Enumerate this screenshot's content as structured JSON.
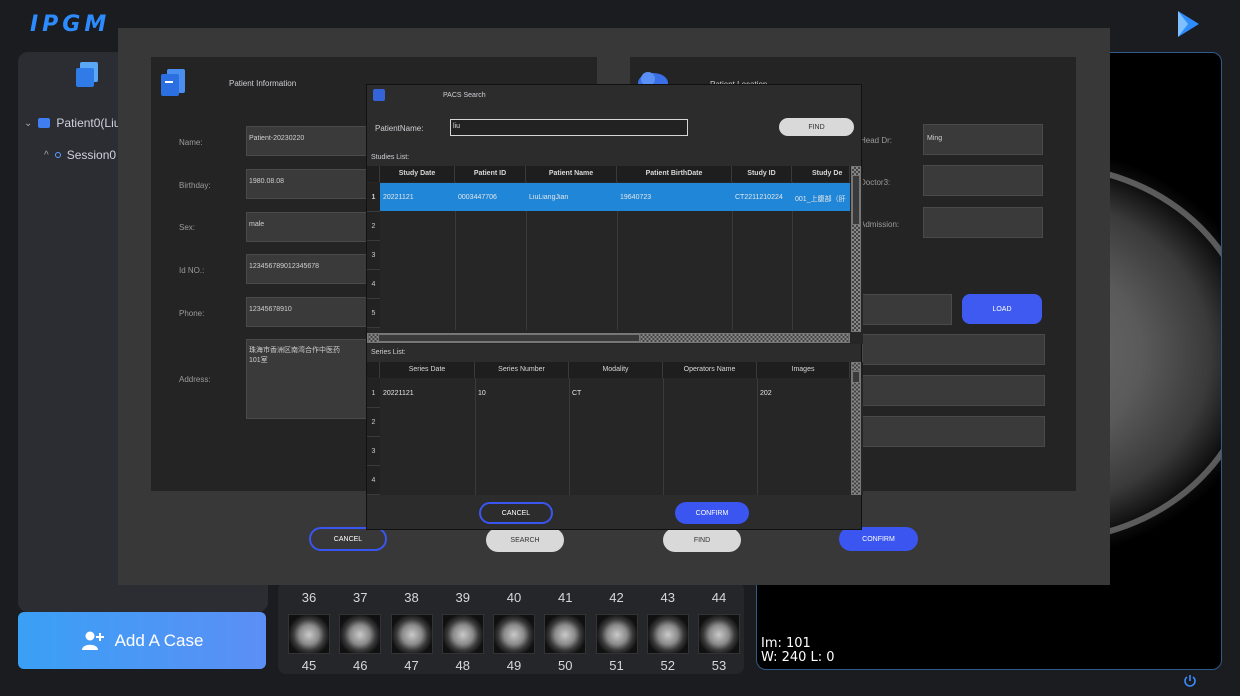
{
  "app": {
    "logo": "IPGM"
  },
  "tree": {
    "patient": "Patient0(Liu",
    "session": "Session0"
  },
  "add_case": {
    "label": "Add A Case"
  },
  "thumbnails": {
    "top_numbers": [
      "36",
      "37",
      "38",
      "39",
      "40",
      "41",
      "42",
      "43",
      "44"
    ],
    "bottom_numbers": [
      "45",
      "46",
      "47",
      "48",
      "49",
      "50",
      "51",
      "52",
      "53"
    ]
  },
  "viewer": {
    "im": "Im: 101",
    "wl": "W:  240  L:    0"
  },
  "patient_info": {
    "title": "Patient Information",
    "name_label": "Name:",
    "name": "Patient-20230220",
    "birthday_label": "Birthday:",
    "birthday": "1980.08.08",
    "sex_label": "Sex:",
    "sex": "male",
    "id_label": "Id NO.:",
    "id": "123456789012345678",
    "phone_label": "Phone:",
    "phone": "12345678910",
    "address_label": "Address:",
    "address": "珠海市香洲区南湾合作中医药\n101室"
  },
  "other_panel": {
    "title": "Patient Location",
    "head_dr_label": "Head Dr:",
    "head_dr": "Ming",
    "doctor3_label": "Doctor3:",
    "admission_label": "Admission:",
    "load_label": "LOAD"
  },
  "modal_buttons": {
    "cancel": "CANCEL",
    "search": "SEARCH",
    "find": "FIND",
    "confirm": "CONFIRM"
  },
  "pacs": {
    "title": "PACS Search",
    "patient_name_label": "PatientName:",
    "patient_name_value": "liu",
    "find": "FIND",
    "studies_label": "Studies List:",
    "studies_columns": [
      "Study Date",
      "Patient ID",
      "Patient Name",
      "Patient BirthDate",
      "Study ID",
      "Study De"
    ],
    "studies_rows": [
      [
        "20221121",
        "0003447706",
        "LiuLiangJian",
        "19640723",
        "CT2211210224",
        "001_上腹部（肝"
      ]
    ],
    "studies_row_numbers": [
      "1",
      "2",
      "3",
      "4",
      "5"
    ],
    "series_label": "Series List:",
    "series_columns": [
      "Series Date",
      "Series Number",
      "Modality",
      "Operators Name",
      "Images"
    ],
    "series_rows": [
      [
        "20221121",
        "10",
        "CT",
        "",
        "202"
      ]
    ],
    "series_row_numbers": [
      "1",
      "2",
      "3",
      "4"
    ],
    "cancel": "CANCEL",
    "confirm": "CONFIRM"
  }
}
